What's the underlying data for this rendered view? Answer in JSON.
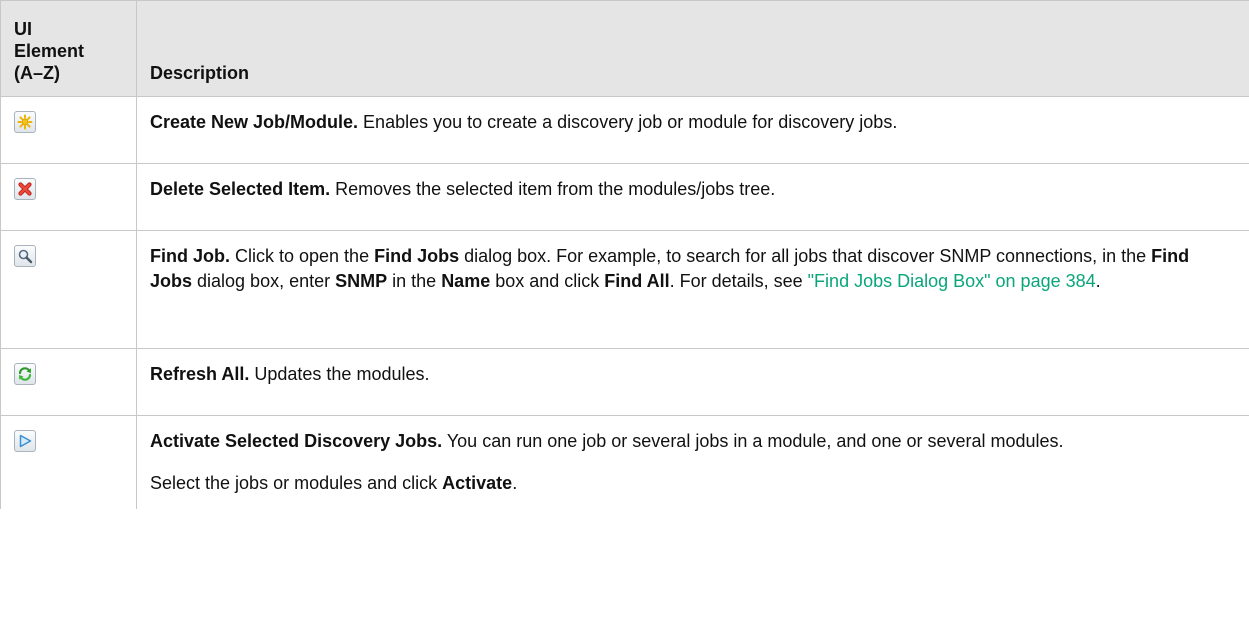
{
  "table": {
    "headers": {
      "element": [
        "UI",
        "Element",
        "(A–Z)"
      ],
      "description": "Description"
    },
    "rows": [
      {
        "icon": "create-new-star-icon",
        "term": "Create New Job/Module.",
        "text": " Enables you to create a discovery job or module for discovery jobs."
      },
      {
        "icon": "delete-x-icon",
        "term": "Delete Selected Item.",
        "text": " Removes the selected item from the modules/jobs tree."
      },
      {
        "icon": "magnifier-search-icon",
        "term": "Find Job.",
        "parts": {
          "a": " Click to open the ",
          "b": "Find Jobs",
          "c": " dialog box. For example, to search for all jobs that discover SNMP connections, in the ",
          "d": "Find Jobs",
          "e": " dialog box, enter ",
          "f": "SNMP",
          "g": " in the ",
          "h": "Name",
          "i": " box and click ",
          "j": "Find All",
          "k": ". For details, see ",
          "link": "\"Find Jobs Dialog Box\" on page 384",
          "l": "."
        }
      },
      {
        "icon": "refresh-arrows-icon",
        "term": "Refresh All.",
        "text": " Updates the modules."
      },
      {
        "icon": "play-triangle-icon",
        "term": "Activate Selected Discovery Jobs.",
        "text": " You can run one job or several jobs in a module, and one or several modules.",
        "para2": {
          "a": "Select the jobs or modules and click ",
          "b": "Activate",
          "c": "."
        }
      }
    ]
  },
  "colors": {
    "header_bg": "#e5e5e5",
    "border": "#c8c8c8",
    "link": "#0aa67a"
  }
}
